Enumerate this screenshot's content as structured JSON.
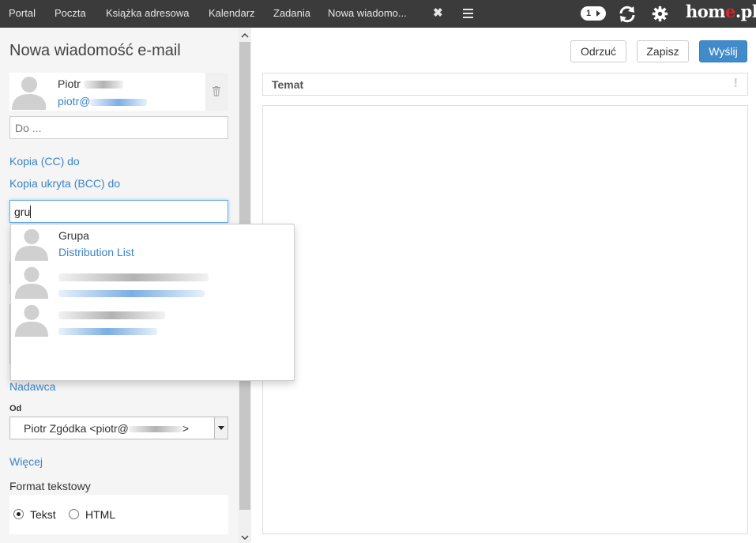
{
  "nav": {
    "items": [
      "Portal",
      "Poczta",
      "Książka adresowa",
      "Kalendarz",
      "Zadania",
      "Nowa wiadomo..."
    ],
    "close_glyph": "✖",
    "menu_icon": "hamburger-icon",
    "badge_count": "1",
    "refresh_icon": "refresh-icon",
    "settings_icon": "gear-icon",
    "logo_prefix": "hom",
    "logo_e": "e",
    "logo_suffix": ".pl"
  },
  "compose": {
    "title": "Nowa wiadomość e-mail",
    "recipient": {
      "name": "Piotr",
      "email_prefix": "piotr@"
    },
    "to_placeholder": "Do ...",
    "cc_link": "Kopia (CC) do",
    "bcc_link": "Kopia ukryta (BCC) do",
    "bcc_value": "gru",
    "sender_link": "Nadawca",
    "from_label": "Od",
    "from_prefix": "Piotr Zgódka <piotr@",
    "from_suffix": ">",
    "more_link": "Więcej",
    "format_label": "Format tekstowy",
    "format_options": [
      {
        "label": "Tekst",
        "checked": true
      },
      {
        "label": "HTML",
        "checked": false
      }
    ]
  },
  "toolbar": {
    "discard": "Odrzuć",
    "save": "Zapisz",
    "send": "Wyślij"
  },
  "message": {
    "subject_placeholder": "Temat",
    "importance_glyph": "!"
  },
  "autocomplete": {
    "items": [
      {
        "name": "Grupa",
        "subtitle": "Distribution List"
      }
    ]
  },
  "colors": {
    "topbar": "#3b3b3b",
    "link": "#3a83c7",
    "primary": "#428bca",
    "logo_accent": "#d9262a"
  }
}
